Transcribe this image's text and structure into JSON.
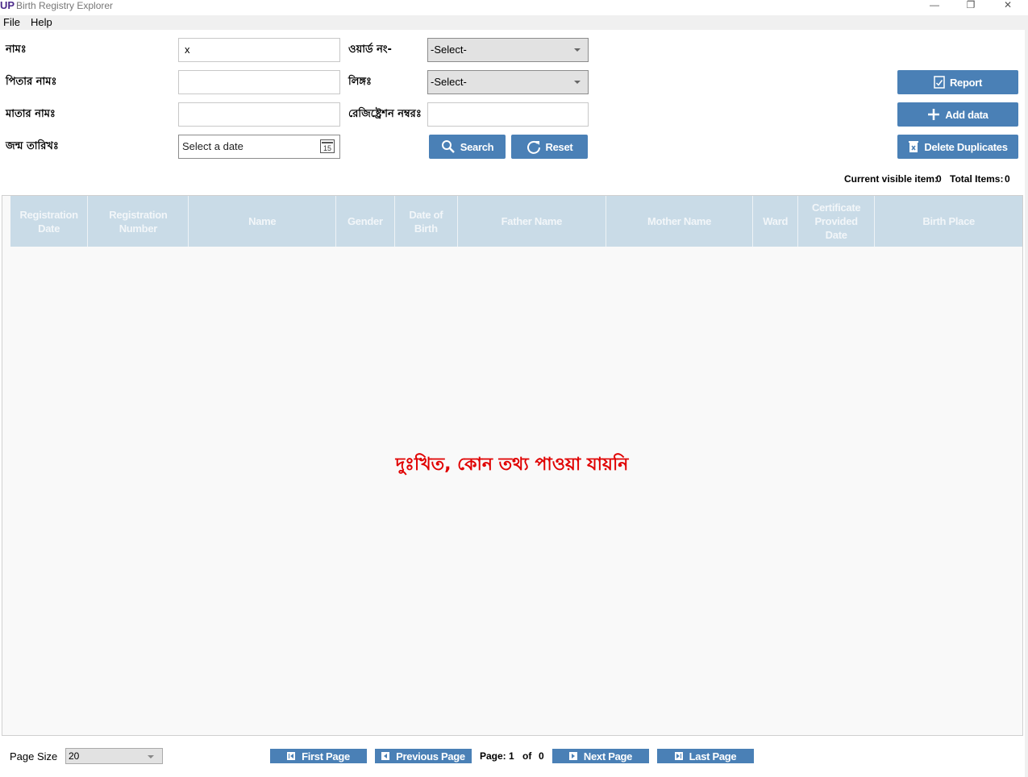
{
  "window": {
    "logo_text": "UP",
    "title": "Birth Registry Explorer",
    "minimize": "—",
    "restore": "❐",
    "close": "✕"
  },
  "menu": {
    "items": [
      "File",
      "Help"
    ]
  },
  "form": {
    "name_label": "নামঃ",
    "name_value": "x",
    "father_label": "পিতার নামঃ",
    "father_value": "",
    "mother_label": "মাতার নামঃ",
    "mother_value": "",
    "dob_label": "জন্ম তারিখঃ",
    "dob_placeholder": "Select a date",
    "calendar_day": "15",
    "ward_label": "ওয়ার্ড নং-",
    "ward_value": "-Select-",
    "gender_label": "লিঙ্গঃ",
    "gender_value": "-Select-",
    "regno_label": "রেজিষ্ট্রেশন নম্বরঃ",
    "regno_value": ""
  },
  "buttons": {
    "search": "Search",
    "reset": "Reset",
    "report": "Report",
    "add_data": "Add data",
    "delete_duplicates": "Delete Duplicates"
  },
  "counts": {
    "visible_label": "Current visible item:",
    "visible_value": "0",
    "total_label": "Total Items:",
    "total_value": "0"
  },
  "table": {
    "columns": [
      {
        "line1": "Registration",
        "line2": "Date"
      },
      {
        "line1": "Registration",
        "line2": "Number"
      },
      {
        "line1": "Name",
        "line2": ""
      },
      {
        "line1": "Gender",
        "line2": ""
      },
      {
        "line1": "Date of",
        "line2": "Birth"
      },
      {
        "line1": "Father Name",
        "line2": ""
      },
      {
        "line1": "Mother Name",
        "line2": ""
      },
      {
        "line1": "Ward",
        "line2": ""
      },
      {
        "line1": "Certificate",
        "line2": "Provided",
        "line3": "Date"
      },
      {
        "line1": "Birth Place",
        "line2": ""
      }
    ],
    "rows": [],
    "empty_message": "দুঃখিত, কোন তথ্য পাওয়া যায়নি"
  },
  "pagination": {
    "page_size_label": "Page Size",
    "page_size_value": "20",
    "first": "First Page",
    "previous": "Previous Page",
    "page_label": "Page:",
    "current_page": "1",
    "of_label": "of",
    "total_pages": "0",
    "next": "Next Page",
    "last": "Last Page"
  },
  "colors": {
    "button_bg": "#4a80b6",
    "header_bg": "#c9dbe7",
    "empty_message": "#e00000"
  }
}
